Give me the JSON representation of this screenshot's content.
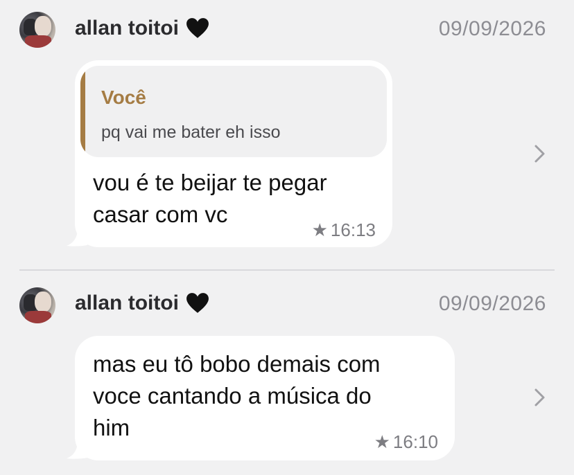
{
  "messages": [
    {
      "sender": "allan toitoi",
      "date": "09/09/2026",
      "quote": {
        "author": "Você",
        "text": "pq vai me bater eh isso"
      },
      "text_lines": [
        "vou é te beijar te pegar",
        "casar com vc"
      ],
      "time": "16:13",
      "starred": true
    },
    {
      "sender": "allan toitoi",
      "date": "09/09/2026",
      "text_lines": [
        "mas eu tô bobo demais com",
        "voce cantando a música do",
        "him"
      ],
      "time": "16:10",
      "starred": true
    }
  ],
  "icons": {
    "heart": "black-heart-icon",
    "star": "star-icon",
    "chevron": "chevron-right-icon"
  },
  "colors": {
    "background": "#f1f1f2",
    "bubble": "#ffffff",
    "quote_accent": "#a57c44",
    "date": "#8d8d93"
  }
}
